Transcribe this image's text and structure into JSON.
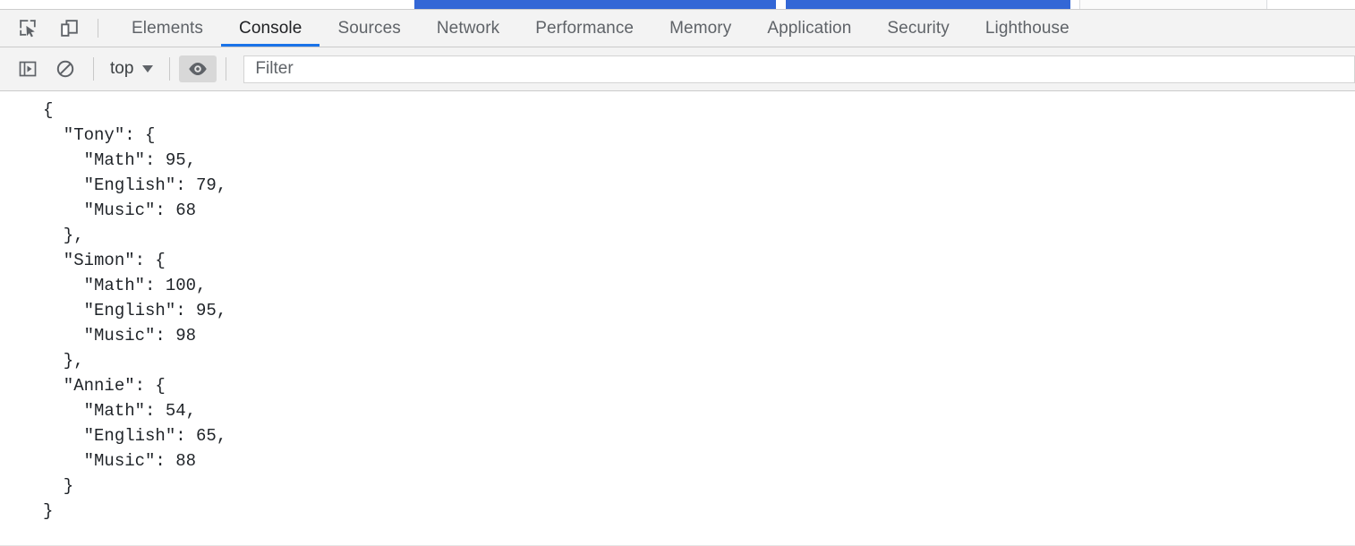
{
  "browser_tab_strip": {
    "tabs": [
      {
        "name": "browser-tab-1",
        "style": "active-blue"
      },
      {
        "name": "browser-tab-2",
        "style": "active-blue"
      },
      {
        "name": "browser-tab-3",
        "style": "inactive-plain"
      }
    ]
  },
  "devtools": {
    "toolbar_icons": [
      {
        "name": "inspect-element-icon",
        "title": "Inspect element"
      },
      {
        "name": "device-toolbar-icon",
        "title": "Toggle device toolbar"
      }
    ],
    "tabs": [
      {
        "label": "Elements",
        "active": false
      },
      {
        "label": "Console",
        "active": true
      },
      {
        "label": "Sources",
        "active": false
      },
      {
        "label": "Network",
        "active": false
      },
      {
        "label": "Performance",
        "active": false
      },
      {
        "label": "Memory",
        "active": false
      },
      {
        "label": "Application",
        "active": false
      },
      {
        "label": "Security",
        "active": false
      },
      {
        "label": "Lighthouse",
        "active": false
      }
    ],
    "active_tab": "Console",
    "accent_color": "#1a73e8"
  },
  "console_toolbar": {
    "sidebar_toggle": {
      "name": "console-sidebar-toggle-icon",
      "label": "Show console sidebar"
    },
    "clear_console": {
      "name": "clear-console-icon",
      "label": "Clear console"
    },
    "context_selector": {
      "value": "top",
      "caret": "chevron-down-icon"
    },
    "eye_toggle": {
      "name": "eye-icon",
      "label": "Create live expression",
      "pressed": true
    },
    "filter": {
      "value": "",
      "placeholder": "Filter"
    }
  },
  "console_output": {
    "logged_value": "{\n  \"Tony\": {\n    \"Math\": 95,\n    \"English\": 79,\n    \"Music\": 68\n  },\n  \"Simon\": {\n    \"Math\": 100,\n    \"English\": 95,\n    \"Music\": 98\n  },\n  \"Annie\": {\n    \"Math\": 54,\n    \"English\": 65,\n    \"Music\": 88\n  }\n}",
    "records": [
      {
        "student": "Tony",
        "Math": 95,
        "English": 79,
        "Music": 68
      },
      {
        "student": "Simon",
        "Math": 100,
        "English": 95,
        "Music": 98
      },
      {
        "student": "Annie",
        "Math": 54,
        "English": 65,
        "Music": 88
      }
    ]
  }
}
